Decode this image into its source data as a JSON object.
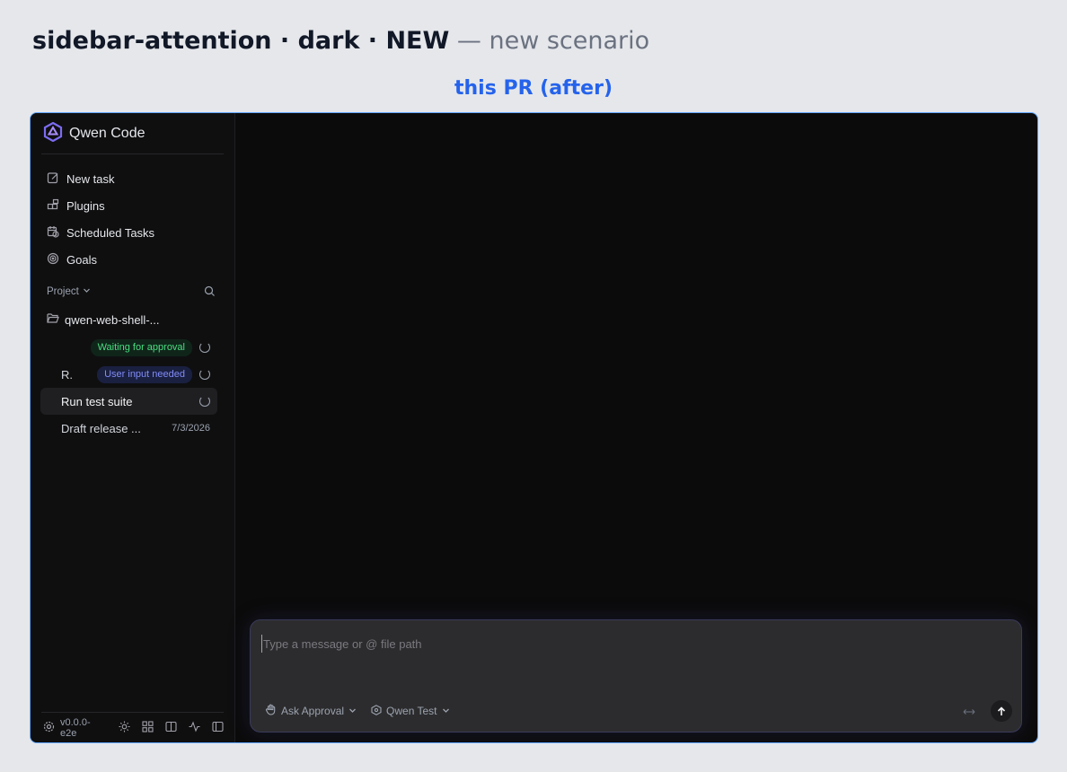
{
  "header": {
    "title": "sidebar-attention · dark · NEW",
    "subtitle": "— new scenario",
    "variant_label": "this PR (after)"
  },
  "app": {
    "brand_name": "Qwen Code",
    "nav": [
      {
        "label": "New task",
        "icon": "edit-icon"
      },
      {
        "label": "Plugins",
        "icon": "plugins-icon"
      },
      {
        "label": "Scheduled Tasks",
        "icon": "calendar-clock-icon"
      },
      {
        "label": "Goals",
        "icon": "target-icon"
      }
    ],
    "section_label": "Project",
    "folder_name": "qwen-web-shell-...",
    "sessions": [
      {
        "title": "",
        "badge": "Waiting for approval",
        "status": "running"
      },
      {
        "title": "R.",
        "badge": "User input needed",
        "status": "running"
      },
      {
        "title": "Run test suite",
        "status": "running",
        "active": true
      },
      {
        "title": "Draft release ...",
        "date": "7/3/2026"
      }
    ],
    "version": "v0.0.0-e2e",
    "composer": {
      "placeholder": "Type a message or @ file path",
      "mode_label": "Ask Approval",
      "model_label": "Qwen Test"
    },
    "colors": {
      "accent_frame": "#60a5fa",
      "approval_badge": "#4ade80",
      "input_badge": "#818cf8",
      "brand_logo": "#7c6cf2"
    }
  }
}
